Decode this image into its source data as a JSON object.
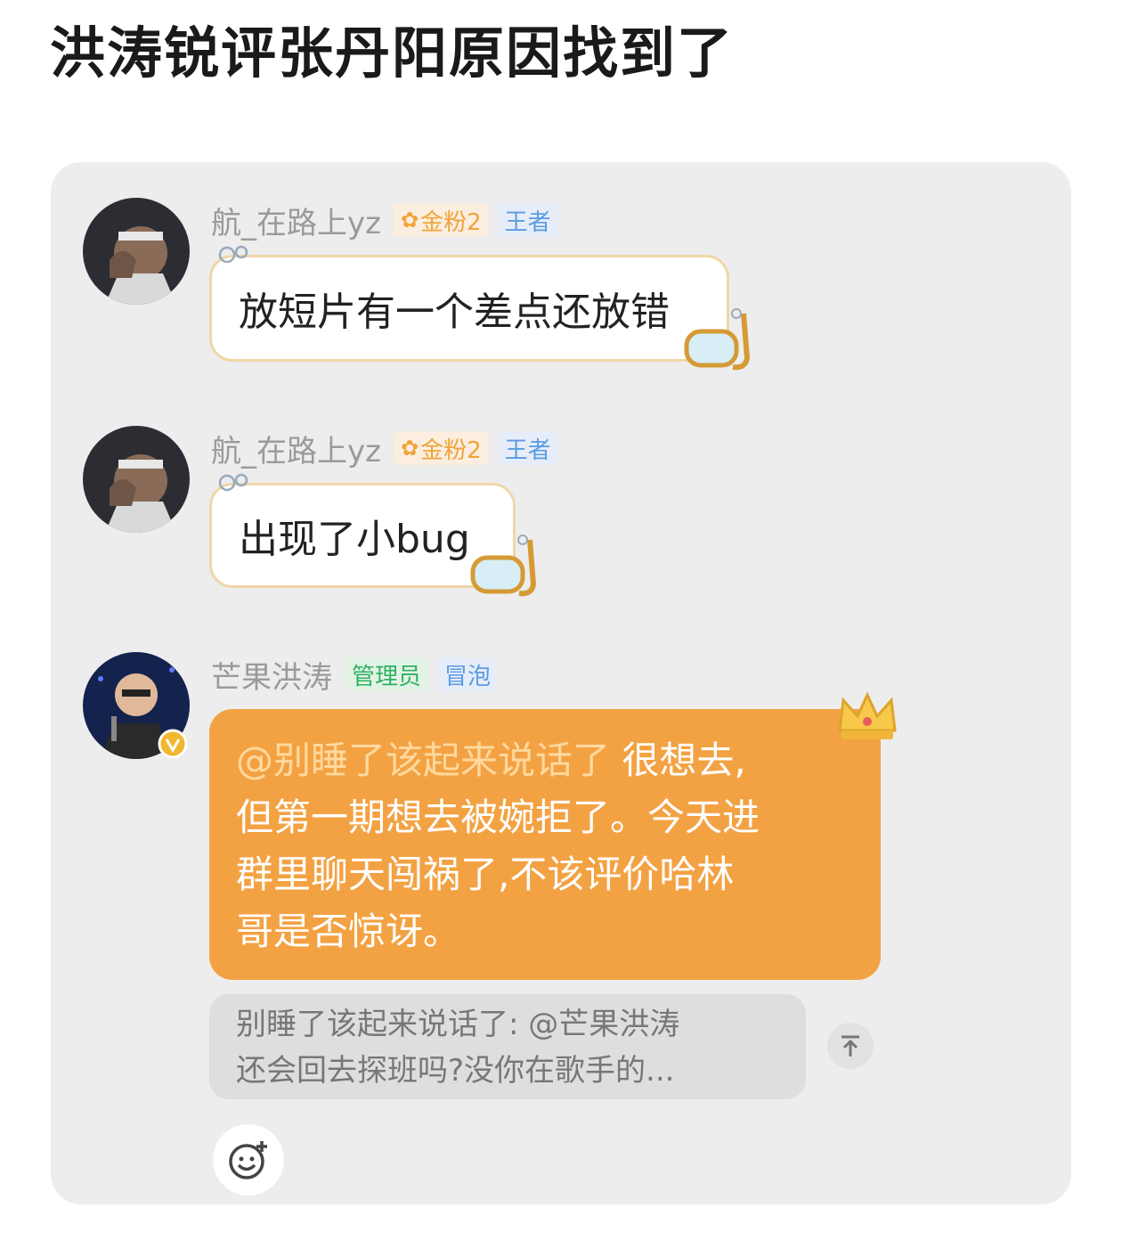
{
  "page": {
    "title": "洪涛锐评张丹阳原因找到了"
  },
  "messages": [
    {
      "username": "航_在路上yz",
      "fan_badge": "金粉2",
      "rank_badge": "王者",
      "text": "放短片有一个差点还放错"
    },
    {
      "username": "航_在路上yz",
      "fan_badge": "金粉2",
      "rank_badge": "王者",
      "text": "出现了小bug"
    },
    {
      "username": "芒果洪涛",
      "role_badge": "管理员",
      "rank_badge": "冒泡",
      "mention": "@别睡了该起来说话了",
      "text_line1": " 很想去,",
      "text_line2": "但第一期想去被婉拒了。今天进",
      "text_line3": "群里聊天闯祸了,不该评价哈林",
      "text_line4": "哥是否惊讶。",
      "quote_line1": "别睡了该起来说话了: @芒果洪涛",
      "quote_line2": "还会回去探班吗?没你在歌手的..."
    }
  ],
  "icons": {
    "scroll_up": "arrow-up-to-top-icon",
    "emoji": "emoji-add-icon",
    "verified": "verified-v-icon",
    "crown": "crown-icon",
    "goggles": "snorkel-goggles-icon"
  },
  "colors": {
    "accent_orange": "#f3a243",
    "card_bg": "#ededed",
    "badge_gold": "#f0a43a",
    "badge_blue": "#5b9be0",
    "badge_green": "#2fb25f"
  }
}
